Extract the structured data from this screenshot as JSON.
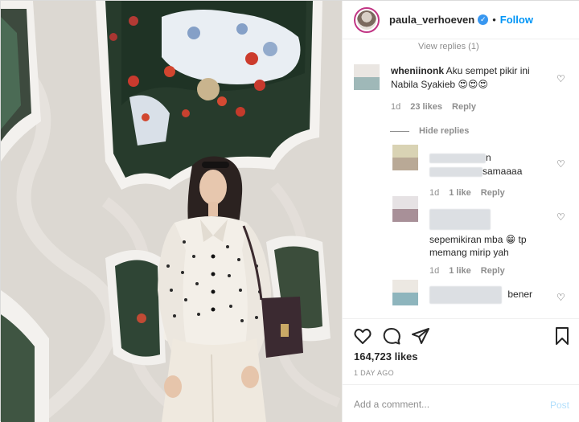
{
  "post": {
    "username": "paula_verhoeven",
    "follow_label": "Follow",
    "separator": "•",
    "likes": "164,723 likes",
    "date": "1 DAY AGO"
  },
  "comments": {
    "cut_off_text": "View replies (1)",
    "top": {
      "username": "wheniinonk",
      "text": "Aku sempet pikir ini Nabila Syakieb 😍😍😍",
      "time": "1d",
      "likes": "23 likes",
      "reply": "Reply"
    },
    "hide_replies": "Hide replies",
    "replies": [
      {
        "text_visible": "samaaaa",
        "prefix_visible": "n",
        "time": "1d",
        "likes": "1 like",
        "reply": "Reply"
      },
      {
        "text": "sepemikiran mba 😁 tp memang mirip yah",
        "time": "1d",
        "likes": "1 like",
        "reply": "Reply"
      },
      {
        "text_visible": "bener"
      }
    ]
  },
  "add_comment": {
    "placeholder": "Add a comment...",
    "post_label": "Post"
  },
  "colors": {
    "accent": "#0095f6",
    "post_disabled": "#b2dffc",
    "muted": "#8e8e8e",
    "verified": "#3897f0"
  },
  "icons": [
    "verified-badge-icon",
    "heart-icon",
    "comment-icon",
    "share-icon",
    "bookmark-icon"
  ]
}
